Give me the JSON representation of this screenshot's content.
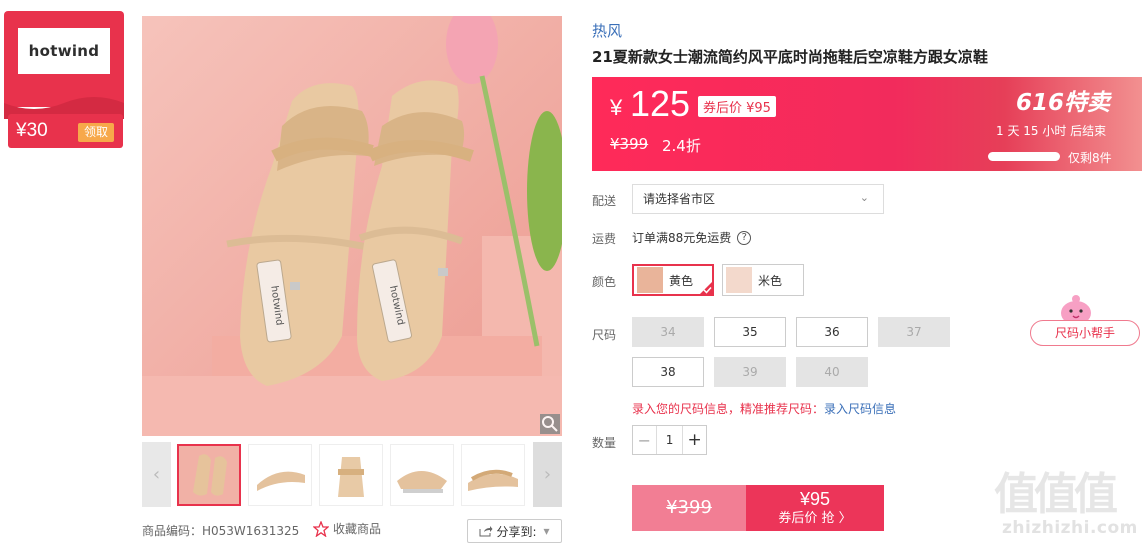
{
  "store": {
    "logo_text": "hotwind",
    "coupon_amount": "¥30",
    "coupon_button": "领取"
  },
  "gallery": {
    "sku_label": "商品编码：H053W1631325",
    "favorite_label": "收藏商品",
    "share_label": "分享到:",
    "share_caret": "▾",
    "prev_arrow": "‹",
    "next_arrow": "›",
    "insole_text": "hotwind"
  },
  "product": {
    "brand": "热风",
    "title": "21夏新款女士潮流简约风平底时尚拖鞋后空凉鞋方跟女凉鞋"
  },
  "price": {
    "currency": "¥",
    "current": "125",
    "after_coupon": "券后价 ¥95",
    "original": "¥399",
    "discount": "2.4折",
    "promo_logo": "616特卖",
    "countdown": "1 天 15 小时 后结束",
    "stock_text": "仅剩8件",
    "stock_fraction": 0.9
  },
  "delivery": {
    "label": "配送",
    "placeholder": "请选择省市区",
    "chevron": "⌄"
  },
  "shipping": {
    "label": "运费",
    "text": "订单满88元免运费",
    "help": "?"
  },
  "colors": {
    "label": "颜色",
    "options": [
      {
        "name": "黄色",
        "selected": true
      },
      {
        "name": "米色",
        "selected": false
      }
    ]
  },
  "sizes": {
    "label": "尺码",
    "options": [
      {
        "size": "34",
        "available": false
      },
      {
        "size": "35",
        "available": true
      },
      {
        "size": "36",
        "available": true
      },
      {
        "size": "37",
        "available": false
      },
      {
        "size": "38",
        "available": true
      },
      {
        "size": "39",
        "available": false
      },
      {
        "size": "40",
        "available": false
      }
    ],
    "helper_button": "尺码小帮手",
    "tip_text": "录入您的尺码信息，精准推荐尺码：",
    "tip_link": "录入尺码信息"
  },
  "quantity": {
    "label": "数量",
    "value": "1",
    "minus": "−",
    "plus": "+"
  },
  "buy": {
    "original": "¥399",
    "price": "¥95",
    "action": "券后价 抢 〉"
  },
  "watermark": {
    "logo": "值值值",
    "text": "zhizhizhi.com"
  },
  "colors_theme": {
    "accent": "#e8324c",
    "link": "#3a6fb8"
  }
}
